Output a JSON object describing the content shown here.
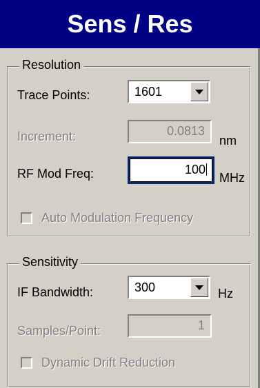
{
  "window": {
    "title": "Sens / Res"
  },
  "resolution": {
    "legend": "Resolution",
    "trace_points": {
      "label": "Trace Points:",
      "value": "1601"
    },
    "increment": {
      "label": "Increment:",
      "value": "0.0813",
      "unit": "nm"
    },
    "rf_mod_freq": {
      "label": "RF Mod Freq:",
      "value": "100",
      "unit": "MHz"
    },
    "auto_modulation": {
      "label": "Auto Modulation Frequency",
      "checked": false
    }
  },
  "sensitivity": {
    "legend": "Sensitivity",
    "if_bandwidth": {
      "label": "IF Bandwidth:",
      "value": "300",
      "unit": "Hz"
    },
    "samples_point": {
      "label": "Samples/Point:",
      "value": "1"
    },
    "dynamic_drift": {
      "label": "Dynamic Drift Reduction",
      "checked": false
    }
  }
}
